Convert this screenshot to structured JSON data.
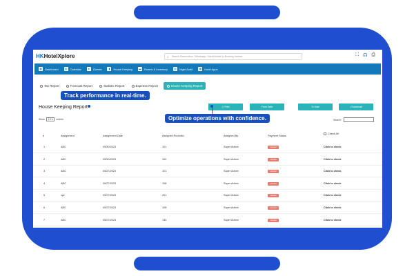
{
  "app": {
    "logo_prefix": "HK",
    "logo_name": "HotelXplore",
    "search_placeholder": "Search Reservation / Whatsapp, Guest Mobile or Booking number"
  },
  "nav": [
    {
      "label": "Dashboard",
      "icon": "dashboard-icon"
    },
    {
      "label": "Calendar",
      "icon": "calendar-icon"
    },
    {
      "label": "Guests",
      "icon": "guests-icon"
    },
    {
      "label": "House Keeping",
      "icon": "housekeeping-icon"
    },
    {
      "label": "Rooms & Inventory",
      "icon": "rooms-icon"
    },
    {
      "label": "Night Audit",
      "icon": "night-audit-icon"
    },
    {
      "label": "Hotel Apps",
      "icon": "apps-icon"
    }
  ],
  "tabs": [
    {
      "label": "Tax Report",
      "active": false
    },
    {
      "label": "Forecast Report",
      "active": false
    },
    {
      "label": "Statistic Report",
      "active": false
    },
    {
      "label": "Expense Report",
      "active": false
    },
    {
      "label": "House Keeping Report",
      "active": true
    }
  ],
  "callouts": {
    "track": "Track performance in real-time.",
    "optimize": "Optimize operations with confidence."
  },
  "page_title": "House Keeping Report",
  "actions": {
    "print": "Print",
    "from_date": "From Date",
    "to_date": "To Date",
    "download": "⤓ Download"
  },
  "show_entries": {
    "show": "Show",
    "value": "10",
    "entries": "entries"
  },
  "search_label": "Search:",
  "columns": {
    "num": "#",
    "assignment": "Assignment",
    "date": "Assignment Date",
    "room": "Assigned RoomNo",
    "by": "Assigned By",
    "status": "Payment Status",
    "check": "Check All"
  },
  "rows": [
    {
      "num": "1",
      "assignment": "ABC",
      "date": "05/30/2023",
      "room": "101",
      "by": "Super Admin",
      "status": "Unpaid",
      "check": "Click to check"
    },
    {
      "num": "2",
      "assignment": "ABC",
      "date": "05/30/2023",
      "room": "102",
      "by": "Super Admin",
      "status": "Unpaid",
      "check": "Click to check"
    },
    {
      "num": "3",
      "assignment": "ABC",
      "date": "05/27/2023",
      "room": "101",
      "by": "Super Admin",
      "status": "Unpaid",
      "check": "Click to check"
    },
    {
      "num": "4",
      "assignment": "ABC",
      "date": "05/27/2023",
      "room": "108",
      "by": "Super Admin",
      "status": "Unpaid",
      "check": "Click to check"
    },
    {
      "num": "5",
      "assignment": "xyz",
      "date": "05/27/2023",
      "room": "201",
      "by": "Super Admin",
      "status": "Unpaid",
      "check": "Click to check"
    },
    {
      "num": "6",
      "assignment": "ABC",
      "date": "05/27/2023",
      "room": "108",
      "by": "Super Admin",
      "status": "Unpaid",
      "check": "Click to check"
    },
    {
      "num": "7",
      "assignment": "ABC",
      "date": "05/27/2023",
      "room": "134",
      "by": "Super Admin",
      "status": "Unpaid",
      "check": "Click to check"
    }
  ],
  "colors": {
    "brand_blue": "#1f4fcf",
    "nav_blue": "#1479b8",
    "teal": "#2ab3b8",
    "unpaid": "#e87b6e"
  }
}
